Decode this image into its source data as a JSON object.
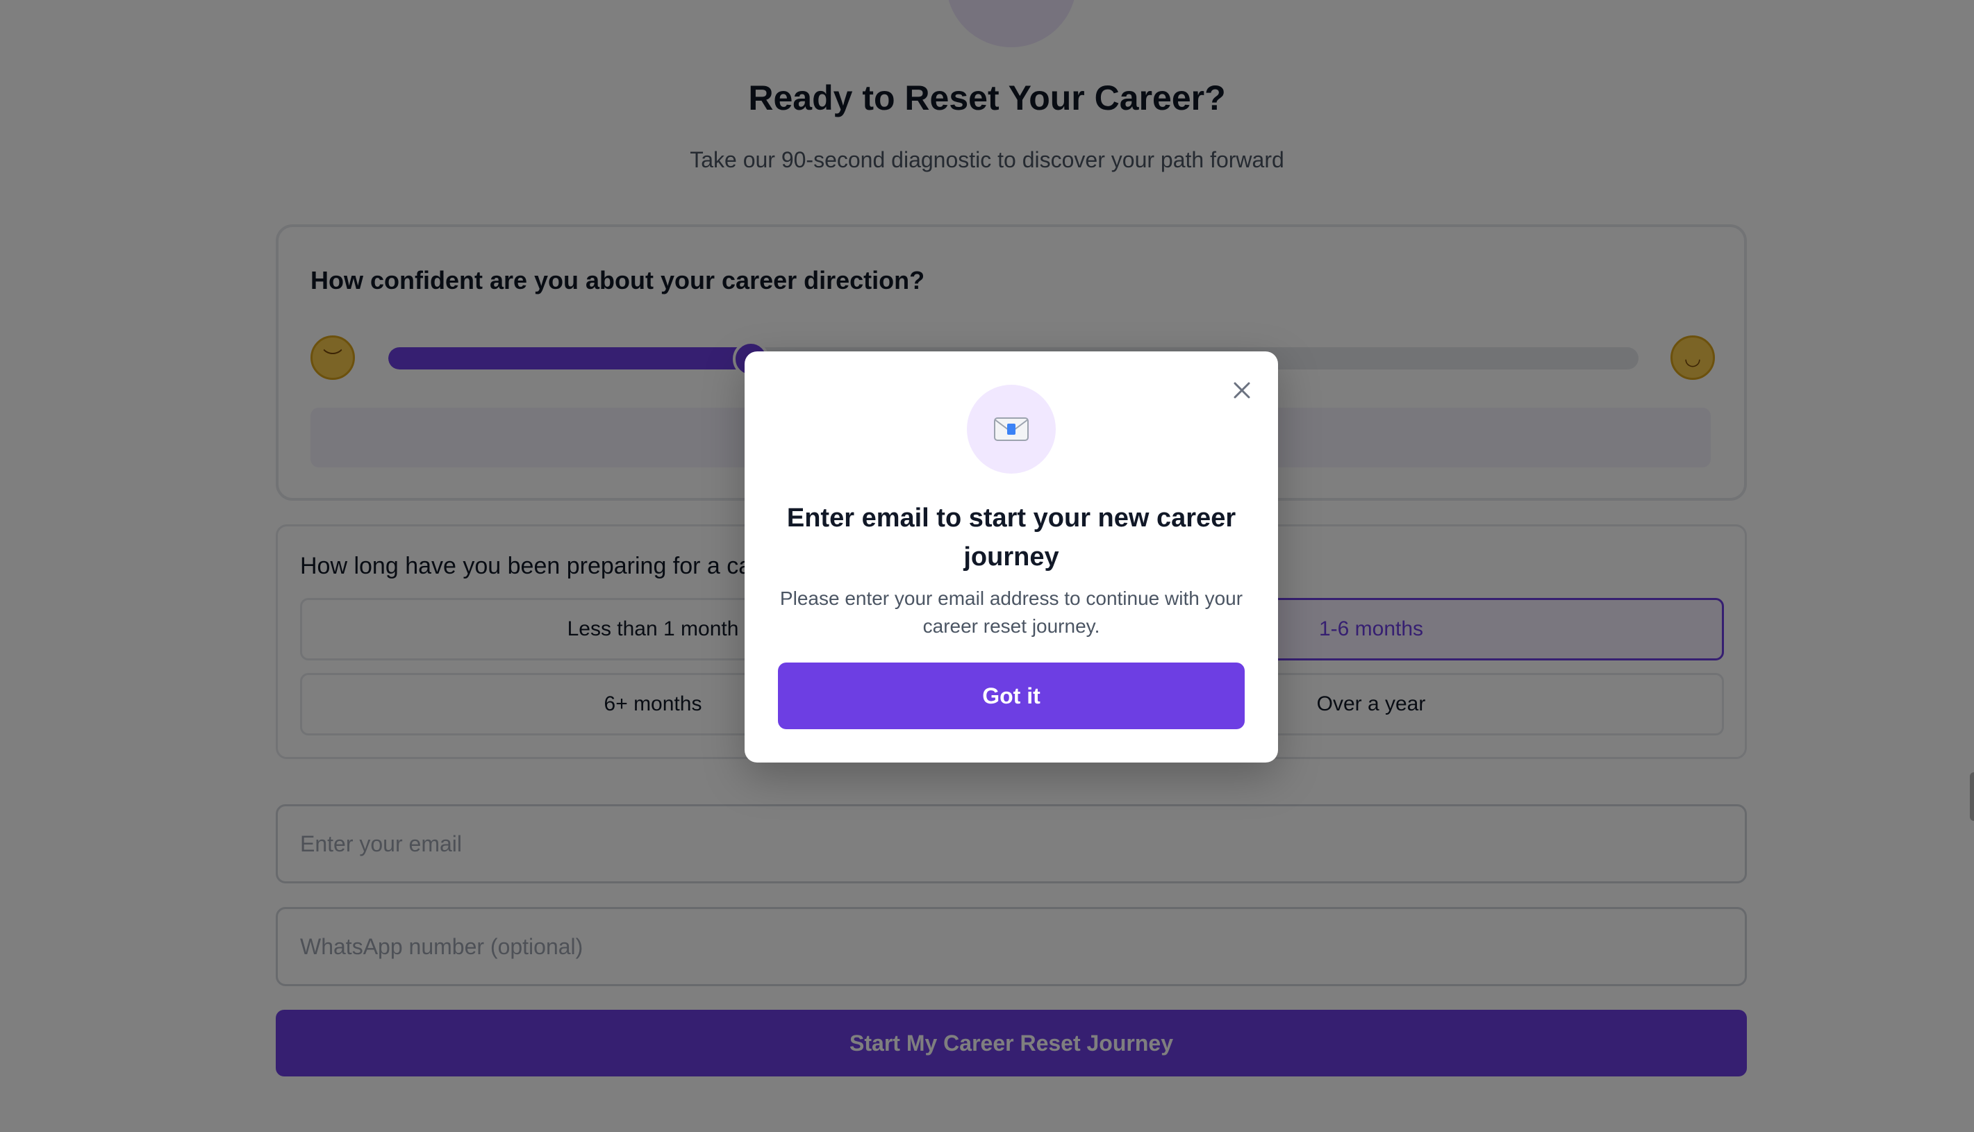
{
  "page": {
    "title": "Ready to Reset Your Career?",
    "subtitle": "Take our 90-second diagnostic to discover your path forward",
    "hero_icon": "rocket-icon"
  },
  "confidence": {
    "question": "How confident are you about your career direction?",
    "left_icon": "pensive-face-icon",
    "right_icon": "smiling-face-icon",
    "value_fraction": 0.29
  },
  "duration": {
    "question": "How long have you been preparing for a career change?",
    "options": [
      {
        "label": "Less than 1 month",
        "selected": false
      },
      {
        "label": "1-6 months",
        "selected": true
      },
      {
        "label": "6+ months",
        "selected": false
      },
      {
        "label": "Over a year",
        "selected": false
      }
    ]
  },
  "form": {
    "email_placeholder": "Enter your email",
    "email_value": "",
    "whatsapp_placeholder": "WhatsApp number (optional)",
    "whatsapp_value": "",
    "submit_label": "Start My Career Reset Journey"
  },
  "modal": {
    "icon": "envelope-icon",
    "title": "Enter email to start your new career journey",
    "text": "Please enter your email address to continue with your career reset journey.",
    "button_label": "Got it",
    "close_icon": "close-icon"
  },
  "colors": {
    "accent": "#6d3ee3",
    "accent_light": "#f1e8ff",
    "overlay": "rgba(0,0,0,0.5)"
  }
}
